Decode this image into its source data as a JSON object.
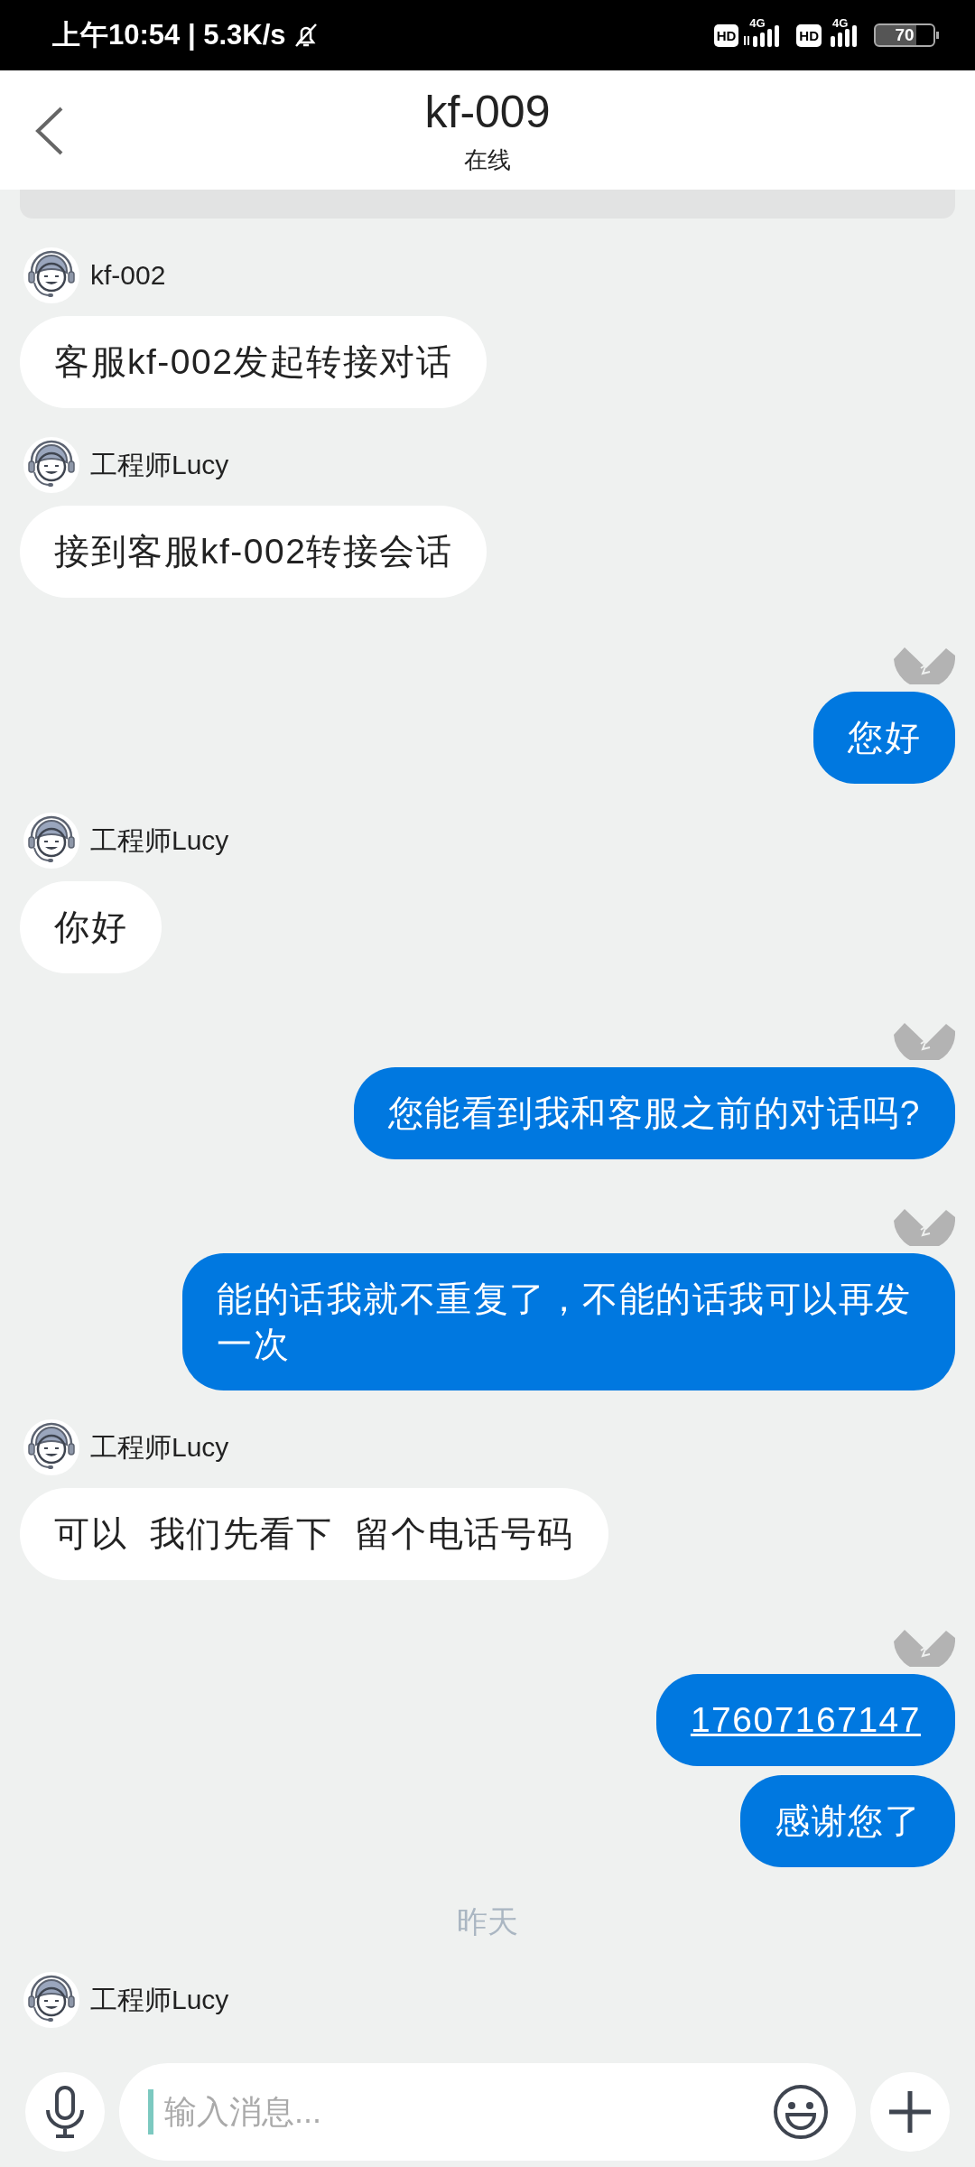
{
  "status_bar": {
    "time": "上午10:54",
    "speed": "| 5.3K/s",
    "sims": [
      {
        "hd": "HD",
        "network": "4G"
      },
      {
        "hd": "HD",
        "network": "4G"
      }
    ],
    "battery": "70"
  },
  "header": {
    "title": "kf-009",
    "subtitle": "在线"
  },
  "messages": [
    {
      "kind": "notice"
    },
    {
      "kind": "incoming",
      "sender": "kf-002",
      "text": "客服kf-002发起转接对话"
    },
    {
      "kind": "incoming",
      "sender": "工程师Lucy",
      "text": "接到客服kf-002转接会话"
    },
    {
      "kind": "outgoing",
      "show_avatar": true,
      "text": "您好",
      "link": false
    },
    {
      "kind": "incoming",
      "sender": "工程师Lucy",
      "text": "你好"
    },
    {
      "kind": "outgoing",
      "show_avatar": true,
      "text": "您能看到我和客服之前的对话吗?",
      "link": false
    },
    {
      "kind": "outgoing",
      "show_avatar": true,
      "text": "能的话我就不重复了，不能的话我可以再发一次",
      "link": false
    },
    {
      "kind": "incoming",
      "sender": "工程师Lucy",
      "text": "可以  我们先看下  留个电话号码"
    },
    {
      "kind": "outgoing",
      "show_avatar": true,
      "text": "17607167147",
      "link": true
    },
    {
      "kind": "outgoing",
      "show_avatar": false,
      "text": "感谢您了",
      "link": false
    },
    {
      "kind": "date",
      "text": "昨天"
    },
    {
      "kind": "incoming",
      "sender": "工程师Lucy"
    }
  ],
  "input": {
    "placeholder": "输入消息..."
  }
}
